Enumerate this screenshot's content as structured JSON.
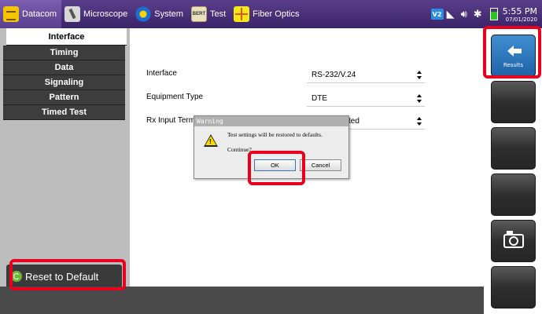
{
  "topbar": {
    "tabs": [
      {
        "label": "Datacom",
        "icon": "datacom-icon",
        "active": true
      },
      {
        "label": "Microscope",
        "icon": "microscope-icon"
      },
      {
        "label": "System",
        "icon": "system-gear-icon"
      },
      {
        "label": "Test",
        "icon": "test-icon",
        "icon_text": "BERT"
      },
      {
        "label": "Fiber Optics",
        "icon": "fiber-optics-icon"
      }
    ],
    "status": {
      "v_badge": "V2",
      "time": "5:55 PM",
      "date": "07/01/2020"
    }
  },
  "leftnav": {
    "items": [
      "Interface",
      "Timing",
      "Data",
      "Signaling",
      "Pattern",
      "Timed Test"
    ],
    "selected": "Interface",
    "reset_button": "Reset to Default"
  },
  "main": {
    "fields": [
      {
        "label": "Interface",
        "value": "RS-232/V.24"
      },
      {
        "label": "Equipment Type",
        "value": "DTE"
      },
      {
        "label": "Rx Input Term",
        "value": "ted"
      }
    ]
  },
  "rightbar": {
    "results_label": "Results"
  },
  "dialog": {
    "title": "Warning",
    "message": "Test settings will be restored to defaults.",
    "question": "Continue?",
    "ok_label": "OK",
    "cancel_label": "Cancel"
  },
  "colors": {
    "topbar": "#4b2f7a",
    "highlight": "#e8001c",
    "results_button": "#2f7ac0"
  }
}
